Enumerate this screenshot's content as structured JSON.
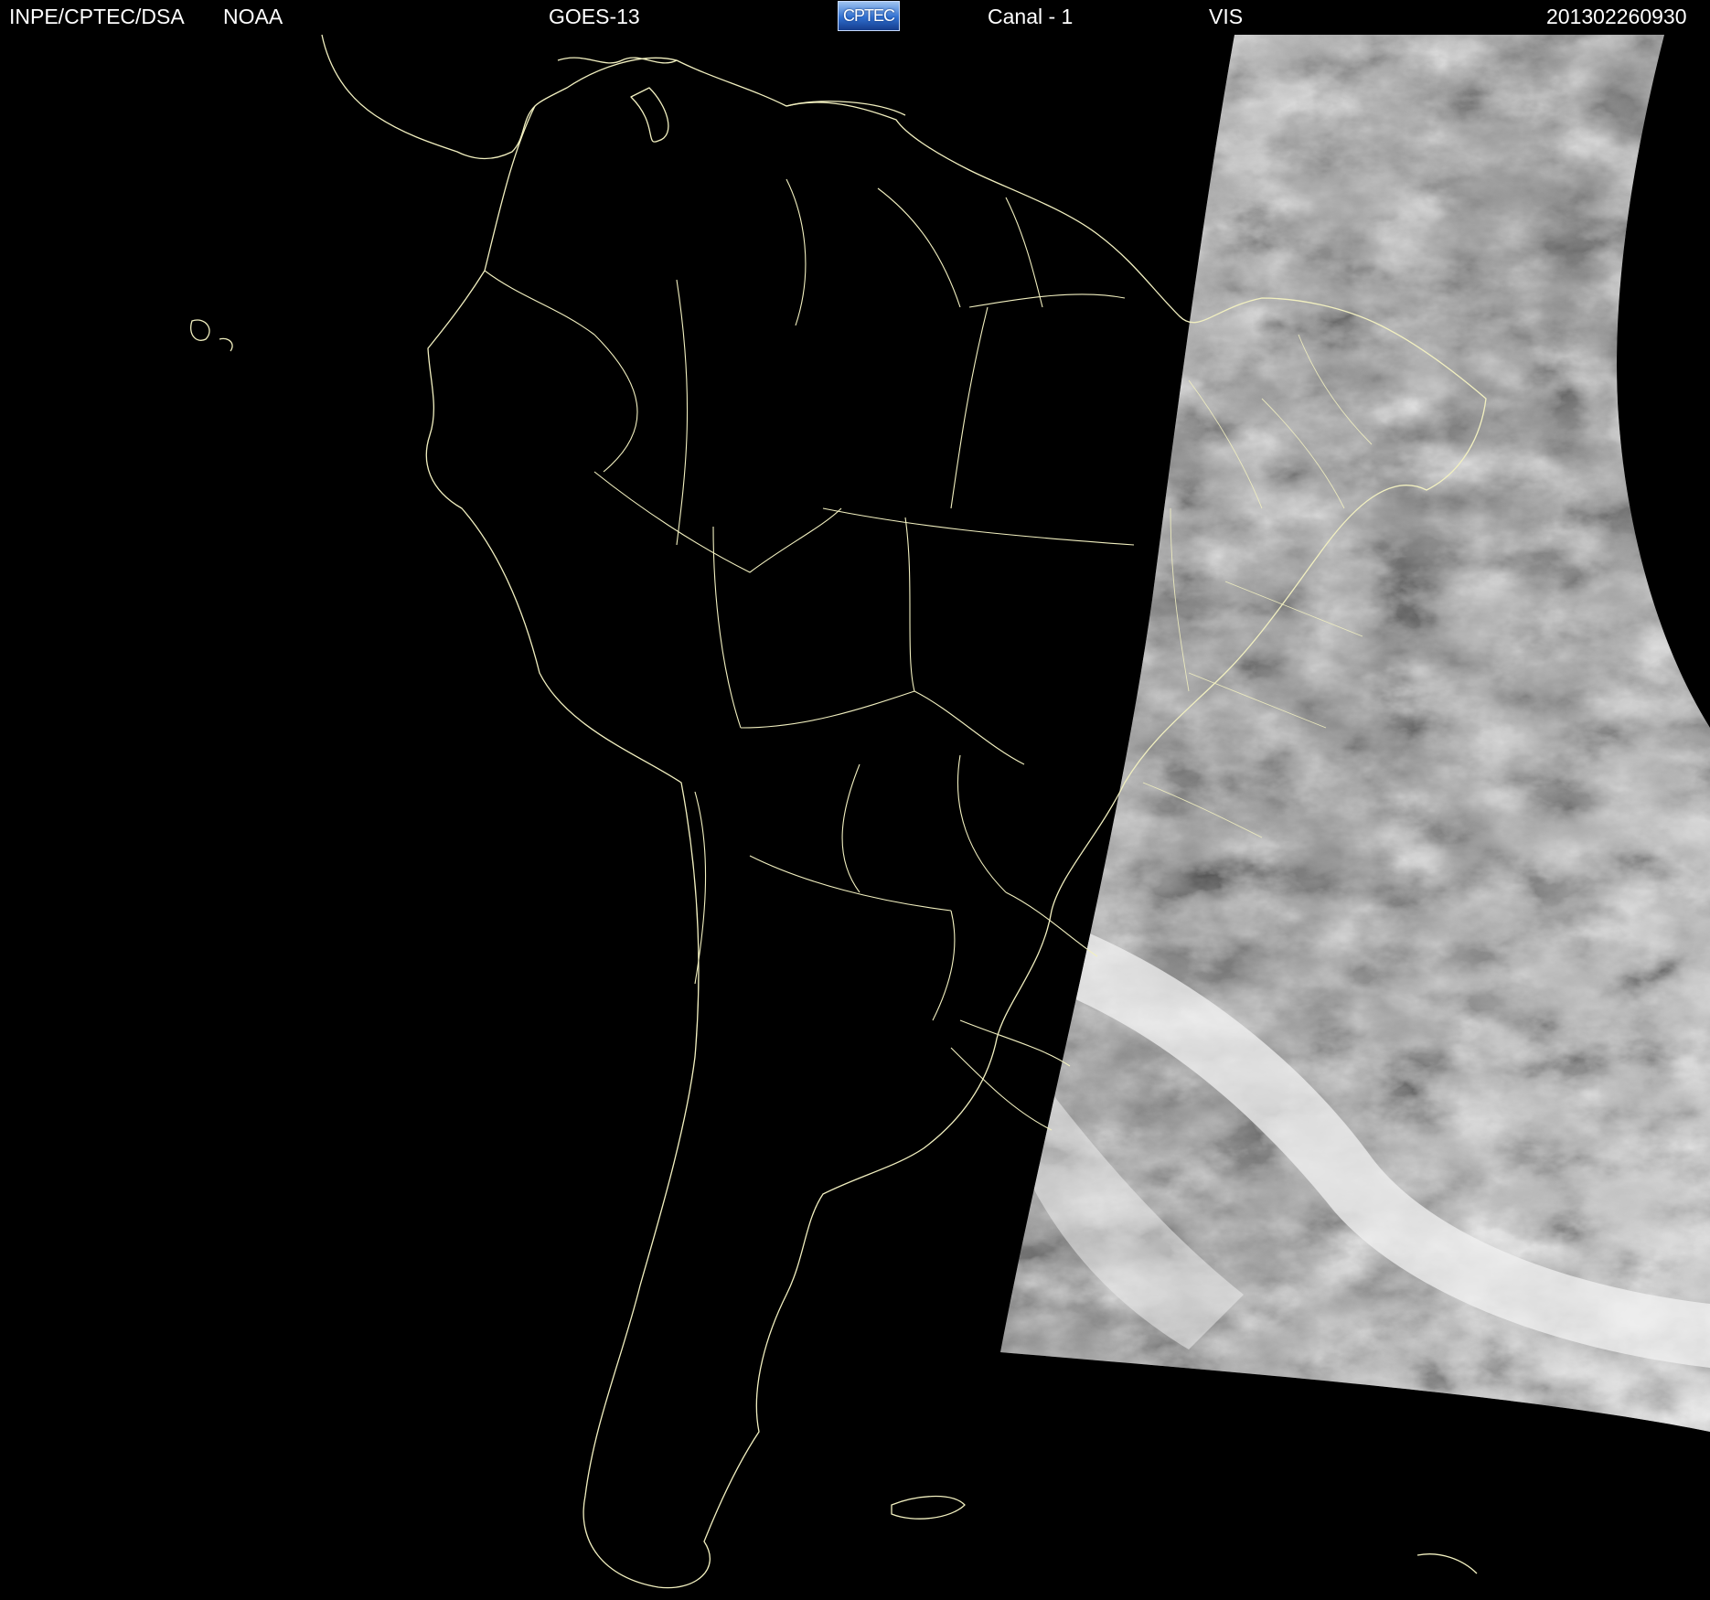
{
  "header": {
    "agency": "INPE/CPTEC/DSA",
    "source": "NOAA",
    "satellite": "GOES-13",
    "logo_text": "CPTEC",
    "channel": "Canal - 1",
    "band": "VIS",
    "timestamp": "201302260930"
  },
  "colors": {
    "background": "#000000",
    "header_text": "#ffffff",
    "coastline": "#f2f0c0",
    "logo_blue": "#2f6fd0"
  },
  "icons": {
    "logo": "cptec-logo"
  }
}
